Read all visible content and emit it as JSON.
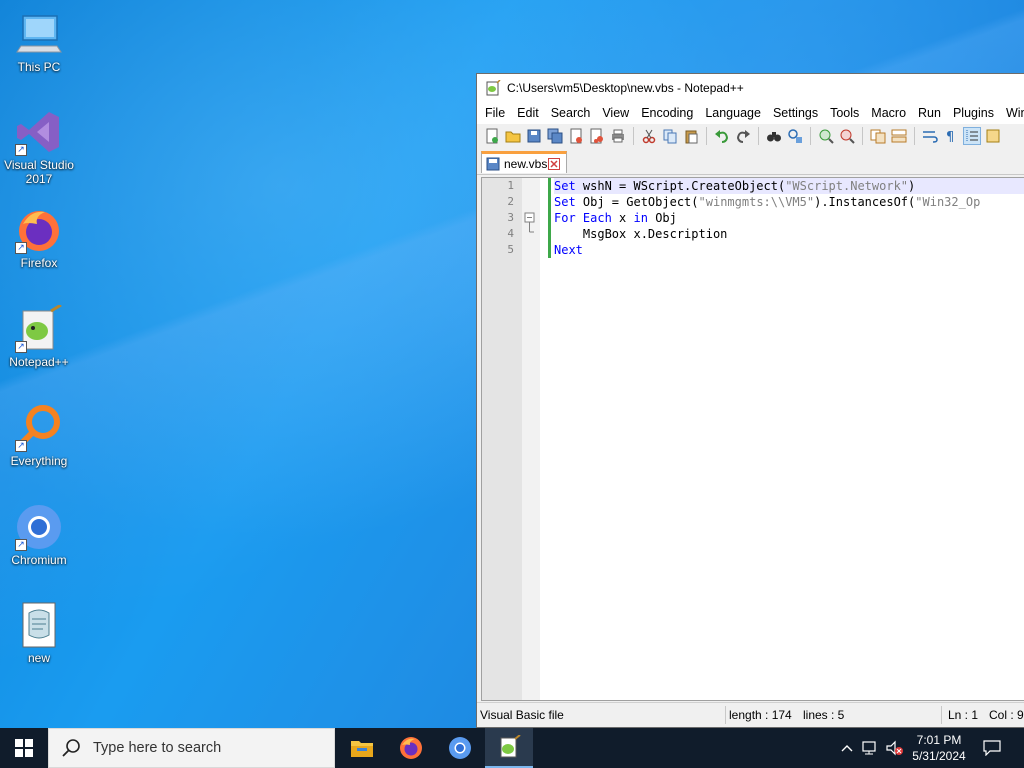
{
  "desktop": {
    "icons": [
      {
        "label": "This PC"
      },
      {
        "label": "Visual Studio 2017"
      },
      {
        "label": "Firefox"
      },
      {
        "label": "Notepad++"
      },
      {
        "label": "Everything"
      },
      {
        "label": "Chromium"
      },
      {
        "label": "new"
      }
    ]
  },
  "window": {
    "title": "C:\\Users\\vm5\\Desktop\\new.vbs - Notepad++",
    "menu": [
      "File",
      "Edit",
      "Search",
      "View",
      "Encoding",
      "Language",
      "Settings",
      "Tools",
      "Macro",
      "Run",
      "Plugins",
      "Wind"
    ],
    "tab": {
      "label": "new.vbs"
    },
    "line_numbers": [
      "1",
      "2",
      "3",
      "4",
      "5"
    ],
    "code": {
      "l1_kw": "Set",
      "l1_rest": " wshN = WScript.CreateObject(",
      "l1_str": "\"WScript.Network\"",
      "l1_end": ")",
      "l2_kw": "Set",
      "l2_rest": " Obj = GetObject(",
      "l2_str": "\"winmgmts:\\\\VM5\"",
      "l2_mid": ").InstancesOf(",
      "l2_str2": "\"Win32_Op",
      "l3_kw1": "For",
      "l3_kw2": "Each",
      "l3_mid": " x ",
      "l3_kw3": "in",
      "l3_end": " Obj",
      "l4": "    MsgBox x.Description",
      "l5_kw": "Next"
    },
    "status": {
      "file_type": "Visual Basic file",
      "length": "length : 174",
      "lines": "lines : 5",
      "ln": "Ln : 1",
      "col": "Col : 9"
    }
  },
  "taskbar": {
    "search_placeholder": "Type here to search",
    "time": "7:01 PM",
    "date": "5/31/2024"
  },
  "colors": {
    "keyword": "#0000ff",
    "string": "#808080",
    "tab_accent": "#f9a03f",
    "change_marker": "#3ea84a",
    "taskbar": "#101c2b"
  }
}
